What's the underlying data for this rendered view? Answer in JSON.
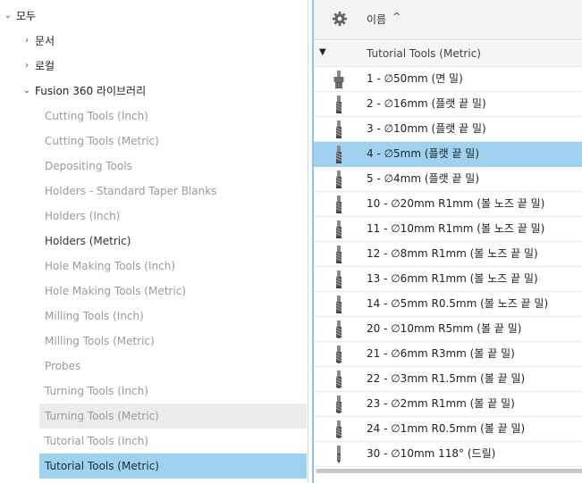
{
  "tree": {
    "root_label": "모두",
    "documents_label": "문서",
    "local_label": "로컬",
    "fusion_label": "Fusion 360 라이브러리",
    "libraries": [
      {
        "label": "Cutting Tools (Inch)",
        "state": "normal"
      },
      {
        "label": "Cutting Tools (Metric)",
        "state": "normal"
      },
      {
        "label": "Depositing Tools",
        "state": "normal"
      },
      {
        "label": "Holders - Standard Taper Blanks",
        "state": "normal"
      },
      {
        "label": "Holders (Inch)",
        "state": "normal"
      },
      {
        "label": "Holders (Metric)",
        "state": "strong"
      },
      {
        "label": "Hole Making Tools (Inch)",
        "state": "normal"
      },
      {
        "label": "Hole Making Tools (Metric)",
        "state": "normal"
      },
      {
        "label": "Milling Tools (Inch)",
        "state": "normal"
      },
      {
        "label": "Milling Tools (Metric)",
        "state": "normal"
      },
      {
        "label": "Probes",
        "state": "normal"
      },
      {
        "label": "Turning Tools (Inch)",
        "state": "normal"
      },
      {
        "label": "Turning Tools (Metric)",
        "state": "hover"
      },
      {
        "label": "Tutorial Tools (Inch)",
        "state": "normal"
      },
      {
        "label": "Tutorial Tools (Metric)",
        "state": "selected"
      }
    ]
  },
  "panel": {
    "gear_icon": "gear-icon",
    "sort_column": "이름",
    "sort_arrow": "^",
    "group_name": "Tutorial Tools (Metric)",
    "tools": [
      {
        "label": "1 - ∅50mm (면 밀)",
        "icon": "face-mill-icon"
      },
      {
        "label": "2 - ∅16mm (플랫 끝 밀)",
        "icon": "flat-end-mill-icon"
      },
      {
        "label": "3 - ∅10mm (플랫 끝 밀)",
        "icon": "flat-end-mill-icon"
      },
      {
        "label": "4 - ∅5mm (플랫 끝 밀)",
        "icon": "flat-end-mill-icon",
        "selected": true
      },
      {
        "label": "5 - ∅4mm (플랫 끝 밀)",
        "icon": "flat-end-mill-icon"
      },
      {
        "label": "10 - ∅20mm R1mm (볼 노즈 끝 밀)",
        "icon": "bull-nose-end-mill-icon"
      },
      {
        "label": "11 - ∅10mm R1mm (볼 노즈 끝 밀)",
        "icon": "bull-nose-end-mill-icon"
      },
      {
        "label": "12 - ∅8mm R1mm (볼 노즈 끝 밀)",
        "icon": "bull-nose-end-mill-icon"
      },
      {
        "label": "13 - ∅6mm R1mm (볼 노즈 끝 밀)",
        "icon": "bull-nose-end-mill-icon"
      },
      {
        "label": "14 - ∅5mm R0.5mm (볼 노즈 끝 밀)",
        "icon": "bull-nose-end-mill-icon"
      },
      {
        "label": "20 - ∅10mm R5mm (볼 끝 밀)",
        "icon": "ball-end-mill-icon"
      },
      {
        "label": "21 - ∅6mm R3mm (볼 끝 밀)",
        "icon": "ball-end-mill-icon"
      },
      {
        "label": "22 - ∅3mm R1.5mm (볼 끝 밀)",
        "icon": "ball-end-mill-icon"
      },
      {
        "label": "23 - ∅2mm R1mm (볼 끝 밀)",
        "icon": "ball-end-mill-icon"
      },
      {
        "label": "24 - ∅1mm R0.5mm (볼 끝 밀)",
        "icon": "ball-end-mill-icon"
      },
      {
        "label": "30 - ∅10mm 118° (드릴)",
        "icon": "drill-icon"
      }
    ]
  },
  "colors": {
    "selection": "#9ed2f0",
    "hover": "#ececec",
    "panel_border": "#8cc3e6"
  }
}
